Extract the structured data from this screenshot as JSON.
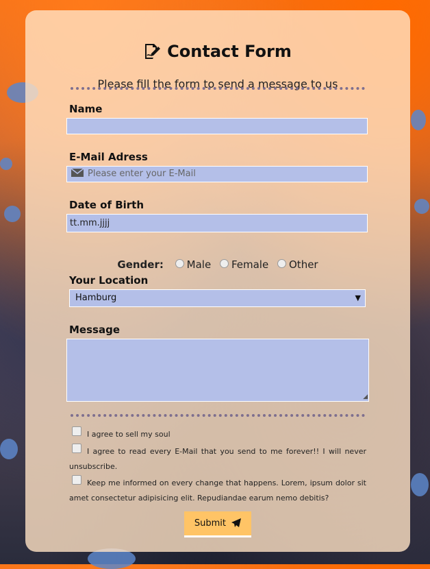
{
  "form": {
    "title": "Contact Form",
    "subtitle": "Please fill the form to send a message to us"
  },
  "name": {
    "label": "Name",
    "value": ""
  },
  "email": {
    "label": "E-Mail Adress",
    "placeholder": "Please enter your E-Mail"
  },
  "dob": {
    "label": "Date of Birth",
    "value": "tt.mm.jjjj"
  },
  "gender": {
    "label": "Gender:",
    "options": [
      "Male",
      "Female",
      "Other"
    ]
  },
  "location": {
    "label": "Your Location",
    "selected": "Hamburg"
  },
  "message": {
    "label": "Message",
    "value": ""
  },
  "checkboxes": [
    {
      "text": "I agree to sell my soul"
    },
    {
      "text": "I agree to read every E-Mail that you send to me forever!! I will never unsubscribe."
    },
    {
      "text": "Keep me informed on every change that happens. Lorem, ipsum dolor sit amet consectetur adipisicing elit. Repudiandae earum nemo debitis?"
    }
  ],
  "submit": {
    "label": "Submit"
  },
  "colors": {
    "card": "#ffe2c4",
    "field": "#b4bfe8",
    "button": "#ffc466",
    "separator": "#7e6f8f"
  }
}
